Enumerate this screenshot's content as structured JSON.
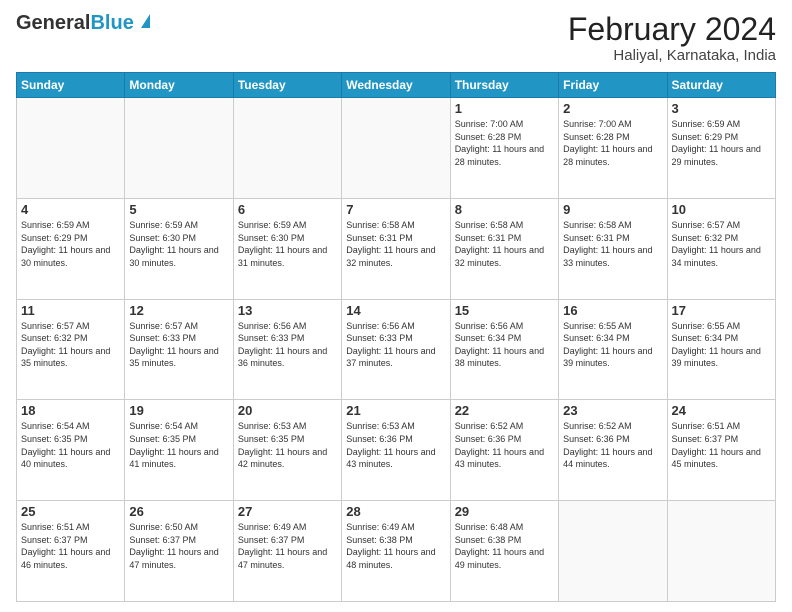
{
  "header": {
    "logo_general": "General",
    "logo_blue": "Blue",
    "month_title": "February 2024",
    "subtitle": "Haliyal, Karnataka, India"
  },
  "weekdays": [
    "Sunday",
    "Monday",
    "Tuesday",
    "Wednesday",
    "Thursday",
    "Friday",
    "Saturday"
  ],
  "weeks": [
    [
      {
        "day": "",
        "info": ""
      },
      {
        "day": "",
        "info": ""
      },
      {
        "day": "",
        "info": ""
      },
      {
        "day": "",
        "info": ""
      },
      {
        "day": "1",
        "info": "Sunrise: 7:00 AM\nSunset: 6:28 PM\nDaylight: 11 hours and 28 minutes."
      },
      {
        "day": "2",
        "info": "Sunrise: 7:00 AM\nSunset: 6:28 PM\nDaylight: 11 hours and 28 minutes."
      },
      {
        "day": "3",
        "info": "Sunrise: 6:59 AM\nSunset: 6:29 PM\nDaylight: 11 hours and 29 minutes."
      }
    ],
    [
      {
        "day": "4",
        "info": "Sunrise: 6:59 AM\nSunset: 6:29 PM\nDaylight: 11 hours and 30 minutes."
      },
      {
        "day": "5",
        "info": "Sunrise: 6:59 AM\nSunset: 6:30 PM\nDaylight: 11 hours and 30 minutes."
      },
      {
        "day": "6",
        "info": "Sunrise: 6:59 AM\nSunset: 6:30 PM\nDaylight: 11 hours and 31 minutes."
      },
      {
        "day": "7",
        "info": "Sunrise: 6:58 AM\nSunset: 6:31 PM\nDaylight: 11 hours and 32 minutes."
      },
      {
        "day": "8",
        "info": "Sunrise: 6:58 AM\nSunset: 6:31 PM\nDaylight: 11 hours and 32 minutes."
      },
      {
        "day": "9",
        "info": "Sunrise: 6:58 AM\nSunset: 6:31 PM\nDaylight: 11 hours and 33 minutes."
      },
      {
        "day": "10",
        "info": "Sunrise: 6:57 AM\nSunset: 6:32 PM\nDaylight: 11 hours and 34 minutes."
      }
    ],
    [
      {
        "day": "11",
        "info": "Sunrise: 6:57 AM\nSunset: 6:32 PM\nDaylight: 11 hours and 35 minutes."
      },
      {
        "day": "12",
        "info": "Sunrise: 6:57 AM\nSunset: 6:33 PM\nDaylight: 11 hours and 35 minutes."
      },
      {
        "day": "13",
        "info": "Sunrise: 6:56 AM\nSunset: 6:33 PM\nDaylight: 11 hours and 36 minutes."
      },
      {
        "day": "14",
        "info": "Sunrise: 6:56 AM\nSunset: 6:33 PM\nDaylight: 11 hours and 37 minutes."
      },
      {
        "day": "15",
        "info": "Sunrise: 6:56 AM\nSunset: 6:34 PM\nDaylight: 11 hours and 38 minutes."
      },
      {
        "day": "16",
        "info": "Sunrise: 6:55 AM\nSunset: 6:34 PM\nDaylight: 11 hours and 39 minutes."
      },
      {
        "day": "17",
        "info": "Sunrise: 6:55 AM\nSunset: 6:34 PM\nDaylight: 11 hours and 39 minutes."
      }
    ],
    [
      {
        "day": "18",
        "info": "Sunrise: 6:54 AM\nSunset: 6:35 PM\nDaylight: 11 hours and 40 minutes."
      },
      {
        "day": "19",
        "info": "Sunrise: 6:54 AM\nSunset: 6:35 PM\nDaylight: 11 hours and 41 minutes."
      },
      {
        "day": "20",
        "info": "Sunrise: 6:53 AM\nSunset: 6:35 PM\nDaylight: 11 hours and 42 minutes."
      },
      {
        "day": "21",
        "info": "Sunrise: 6:53 AM\nSunset: 6:36 PM\nDaylight: 11 hours and 43 minutes."
      },
      {
        "day": "22",
        "info": "Sunrise: 6:52 AM\nSunset: 6:36 PM\nDaylight: 11 hours and 43 minutes."
      },
      {
        "day": "23",
        "info": "Sunrise: 6:52 AM\nSunset: 6:36 PM\nDaylight: 11 hours and 44 minutes."
      },
      {
        "day": "24",
        "info": "Sunrise: 6:51 AM\nSunset: 6:37 PM\nDaylight: 11 hours and 45 minutes."
      }
    ],
    [
      {
        "day": "25",
        "info": "Sunrise: 6:51 AM\nSunset: 6:37 PM\nDaylight: 11 hours and 46 minutes."
      },
      {
        "day": "26",
        "info": "Sunrise: 6:50 AM\nSunset: 6:37 PM\nDaylight: 11 hours and 47 minutes."
      },
      {
        "day": "27",
        "info": "Sunrise: 6:49 AM\nSunset: 6:37 PM\nDaylight: 11 hours and 47 minutes."
      },
      {
        "day": "28",
        "info": "Sunrise: 6:49 AM\nSunset: 6:38 PM\nDaylight: 11 hours and 48 minutes."
      },
      {
        "day": "29",
        "info": "Sunrise: 6:48 AM\nSunset: 6:38 PM\nDaylight: 11 hours and 49 minutes."
      },
      {
        "day": "",
        "info": ""
      },
      {
        "day": "",
        "info": ""
      }
    ]
  ]
}
